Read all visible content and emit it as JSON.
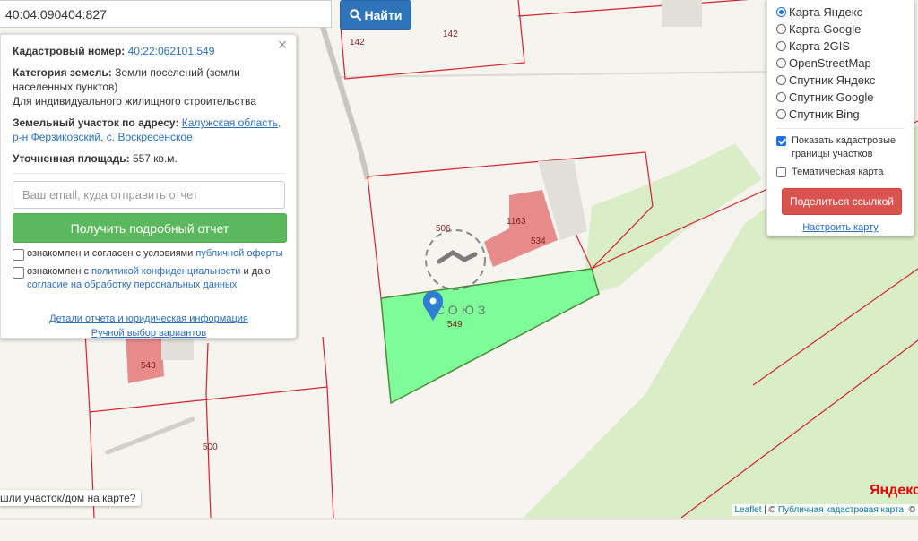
{
  "search": {
    "value": "40:04:090404:827",
    "button_label": "Найти"
  },
  "map": {
    "parcel_labels": {
      "p142a": "142",
      "p142b": "142",
      "p534": "534",
      "p1163": "1163",
      "p549": "549",
      "p543": "543",
      "p500": "500",
      "p506": "506"
    },
    "watermark": "СОЮЗ",
    "colors": {
      "boundary": "#d8202a",
      "selected_fill": "#7ffc9a",
      "forest": "#d9edc7",
      "building_red": "#e88b8b"
    }
  },
  "info": {
    "cadastral_label": "Кадастровый номер:",
    "cadastral_value": "40:22:062101:549",
    "category_label": "Категория земель:",
    "category_value": "Земли поселений (земли населенных пунктов)",
    "category_use": "Для индивидуального жилищного строительства",
    "address_label": "Земельный участок по адресу:",
    "address_value": "Калужская область, р-н Ферзиковский, с. Воскресенское",
    "area_label": "Уточненная площадь:",
    "area_value": "557 кв.м.",
    "email_placeholder": "Ваш email, куда отправить отчет",
    "report_button": "Получить подробный отчет",
    "agree1_text": "ознакомлен и согласен с условиями ",
    "agree1_link": "публичной оферты",
    "agree2_text": "ознакомлен с ",
    "agree2_link1": "политикой конфиденциальности",
    "agree2_mid": " и даю ",
    "agree2_link2": "согласие на обработку персональных данных",
    "details_link": "Детали отчета и юридическая информация",
    "manual_link": "Ручной выбор вариантов"
  },
  "layers": {
    "options": [
      {
        "label": "Карта Яндекс",
        "selected": true
      },
      {
        "label": "Карта Google",
        "selected": false
      },
      {
        "label": "Карта 2GIS",
        "selected": false
      },
      {
        "label": "OpenStreetMap",
        "selected": false
      },
      {
        "label": "Спутник Яндекс",
        "selected": false
      },
      {
        "label": "Спутник Google",
        "selected": false
      },
      {
        "label": "Спутник Bing",
        "selected": false
      }
    ],
    "show_boundaries": "Показать кадастровые границы участков",
    "thematic": "Тематическая карта",
    "share_button": "Поделиться ссылкой",
    "tune_link": "Настроить карту"
  },
  "found_tab": "шли участок/дом на карте?",
  "yandex_logo": "Яндекс",
  "attribution": {
    "leaflet": "Leaflet",
    "sep": " | © ",
    "cadastral": "Публичная кадастровая карта",
    "tail": ", ©"
  }
}
